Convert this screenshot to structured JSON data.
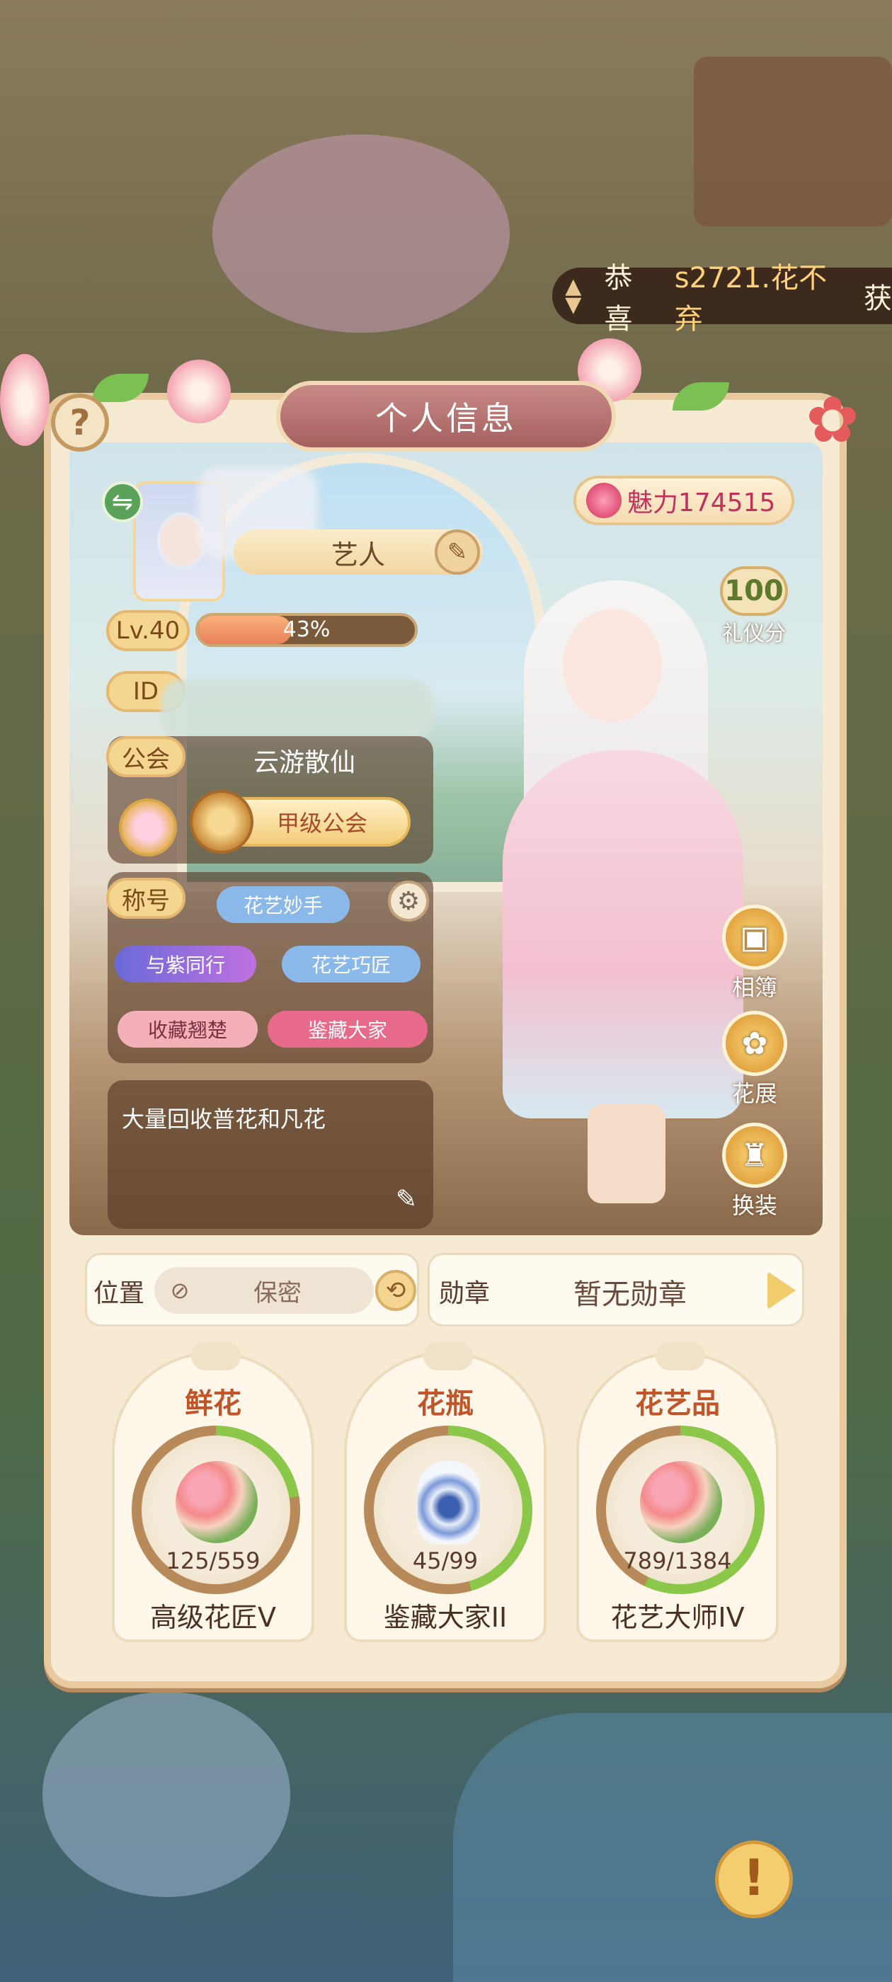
{
  "banner": {
    "prefix": "恭喜",
    "player": "s2721.花不弃",
    "tail": "获"
  },
  "panel": {
    "title": "个人信息"
  },
  "profile": {
    "name": "艺人",
    "charm": "魅力174515",
    "etiquette": {
      "score": "100",
      "label": "礼仪分"
    },
    "level_label": "Lv.40",
    "level_progress": "43%",
    "level_fraction": 0.43,
    "id_label": "ID",
    "guild_label": "公会",
    "guild_name": "云游散仙",
    "guild_rank": "甲级公会",
    "title_label": "称号",
    "titles": [
      "花艺妙手",
      "与紫同行",
      "花艺巧匠",
      "收藏翘楚",
      "鉴藏大家"
    ],
    "signature": "大量回收普花和凡花"
  },
  "side_buttons": [
    {
      "label": "相簿",
      "icon": "photo-album-icon"
    },
    {
      "label": "花展",
      "icon": "flower-show-icon"
    },
    {
      "label": "换装",
      "icon": "dress-up-icon"
    }
  ],
  "location": {
    "label": "位置",
    "value": "保密"
  },
  "medal": {
    "label": "勋章",
    "value": "暂无勋章"
  },
  "collections": [
    {
      "head": "鲜花",
      "count": "125/559",
      "rank": "高级花匠V",
      "fraction": 0.224
    },
    {
      "head": "花瓶",
      "count": "45/99",
      "rank": "鉴藏大家II",
      "fraction": 0.455
    },
    {
      "head": "花艺品",
      "count": "789/1384",
      "rank": "花艺大师IV",
      "fraction": 0.57
    }
  ],
  "colors": {
    "ring_fill": "#8bc84a",
    "ring_track": "#b88a5a",
    "accent": "#c0552a"
  }
}
